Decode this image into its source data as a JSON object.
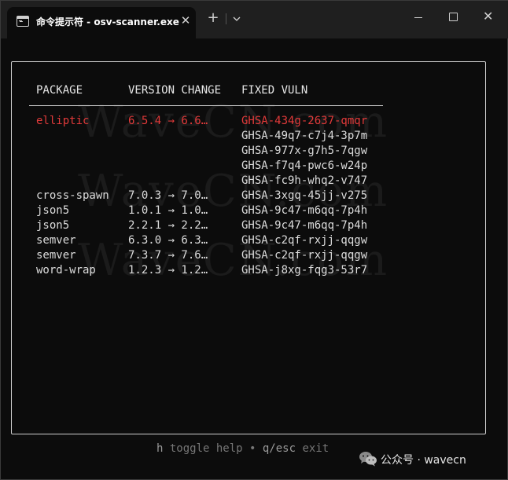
{
  "window": {
    "tab_title": "命令提示符 - osv-scanner.exe",
    "tab_close_glyph": "✕",
    "new_tab_glyph": "+",
    "close_glyph": "✕",
    "icons": [
      "terminal-icon",
      "close-icon",
      "plus-icon",
      "chevron-down-icon",
      "minimize-icon",
      "maximize-icon",
      "close-icon"
    ]
  },
  "table": {
    "headers": {
      "package": "PACKAGE",
      "version_change": "VERSION CHANGE",
      "fixed_vuln": "FIXED VULN"
    },
    "rows": [
      {
        "package": "elliptic",
        "version_change": "6.5.4 → 6.6…",
        "fixed_vuln": "GHSA-434g-2637-qmqr",
        "selected": true
      },
      {
        "package": "",
        "version_change": "",
        "fixed_vuln": "GHSA-49q7-c7j4-3p7m",
        "selected": false
      },
      {
        "package": "",
        "version_change": "",
        "fixed_vuln": "GHSA-977x-g7h5-7qgw",
        "selected": false
      },
      {
        "package": "",
        "version_change": "",
        "fixed_vuln": "GHSA-f7q4-pwc6-w24p",
        "selected": false
      },
      {
        "package": "",
        "version_change": "",
        "fixed_vuln": "GHSA-fc9h-whq2-v747",
        "selected": false
      },
      {
        "package": "cross-spawn",
        "version_change": "7.0.3 → 7.0…",
        "fixed_vuln": "GHSA-3xgq-45jj-v275",
        "selected": false
      },
      {
        "package": "json5",
        "version_change": "1.0.1 → 1.0…",
        "fixed_vuln": "GHSA-9c47-m6qq-7p4h",
        "selected": false
      },
      {
        "package": "json5",
        "version_change": "2.2.1 → 2.2…",
        "fixed_vuln": "GHSA-9c47-m6qq-7p4h",
        "selected": false
      },
      {
        "package": "semver",
        "version_change": "6.3.0 → 6.3…",
        "fixed_vuln": "GHSA-c2qf-rxjj-qqgw",
        "selected": false
      },
      {
        "package": "semver",
        "version_change": "7.3.7 → 7.6…",
        "fixed_vuln": "GHSA-c2qf-rxjj-qqgw",
        "selected": false
      },
      {
        "package": "word-wrap",
        "version_change": "1.2.3 → 1.2…",
        "fixed_vuln": "GHSA-j8xg-fqg3-53r7",
        "selected": false
      }
    ]
  },
  "footer": {
    "help_key": "h",
    "help_text": " toggle help ",
    "dot": "•",
    "exit_key": " q/esc",
    "exit_text": " exit"
  },
  "watermark": {
    "text": "WaveCN.com"
  },
  "wechat": {
    "label": "公众号 · wavecn"
  },
  "colors": {
    "selected_row": "#e23a3a",
    "text": "#dcdcdc",
    "background": "#0c0c0c",
    "titlebar": "#1f1f1f"
  }
}
